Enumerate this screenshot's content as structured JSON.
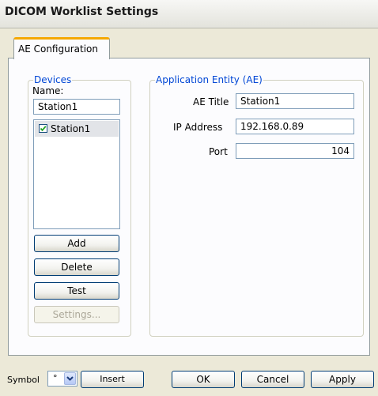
{
  "window": {
    "title": "DICOM Worklist Settings"
  },
  "tabs": [
    {
      "label": "AE Configuration"
    }
  ],
  "devices": {
    "legend": "Devices",
    "name_label": "Name:",
    "name_value": "Station1",
    "list": [
      {
        "label": "Station1",
        "checked": true
      }
    ],
    "buttons": {
      "add": "Add",
      "delete": "Delete",
      "test": "Test",
      "settings": "Settings..."
    }
  },
  "ae": {
    "legend": "Application Entity (AE)",
    "title_label": "AE Title",
    "title_value": "Station1",
    "ip_label": "IP Address",
    "ip_value": "192.168.0.89",
    "port_label": "Port",
    "port_value": "104"
  },
  "footer": {
    "symbol_label": "Symbol",
    "symbol_value": "°",
    "insert_label": "Insert",
    "ok_label": "OK",
    "cancel_label": "Cancel",
    "apply_label": "Apply"
  },
  "colors": {
    "tab_accent": "#f5a800",
    "legend_text": "#0046d5",
    "checkmark": "#21a121"
  },
  "icons": {
    "checkbox": "checkbox-checked-icon",
    "dropdown": "chevron-down-icon"
  }
}
